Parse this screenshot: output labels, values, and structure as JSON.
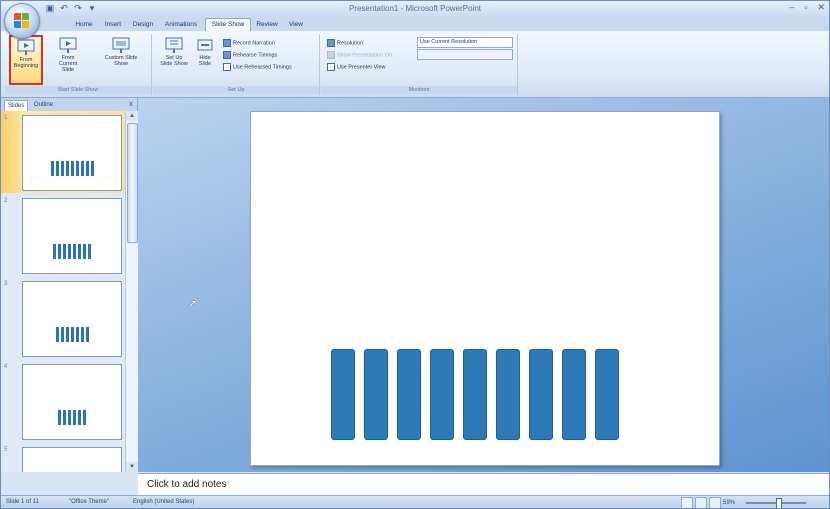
{
  "window": {
    "title": "Presentation1 - Microsoft PowerPoint",
    "controls": [
      "–",
      "▫",
      "✕"
    ]
  },
  "quick_access": [
    "save-icon",
    "undo-icon",
    "redo-icon",
    "dropdown-icon"
  ],
  "tabs": [
    {
      "label": "Home",
      "active": false
    },
    {
      "label": "Insert",
      "active": false
    },
    {
      "label": "Design",
      "active": false
    },
    {
      "label": "Animations",
      "active": false
    },
    {
      "label": "Slide Show",
      "active": true
    },
    {
      "label": "Review",
      "active": false
    },
    {
      "label": "View",
      "active": false
    }
  ],
  "ribbon": {
    "start_group": {
      "label": "Start Slide Show",
      "from_beginning": "From Beginning",
      "from_current": "From Current Slide",
      "custom": "Custom Slide Show"
    },
    "setup_group": {
      "label": "Set Up",
      "setup_show": "Set Up Slide Show",
      "hide_slide": "Hide Slide",
      "record_narration": "Record Narration",
      "rehearse": "Rehearse Timings",
      "use_timings": "Use Rehearsed Timings"
    },
    "monitors_group": {
      "label": "Monitors",
      "resolution_label": "Resolution:",
      "resolution_value": "Use Current Resolution",
      "show_on": "Show Presentation On:",
      "presenter_view": "Use Presenter View"
    }
  },
  "left_pane": {
    "tab_slides": "Slides",
    "tab_outline": "Outline",
    "close": "x",
    "thumbnails": [
      {
        "number": "1",
        "bars": 9,
        "selected": true
      },
      {
        "number": "2",
        "bars": 8,
        "selected": false
      },
      {
        "number": "3",
        "bars": 7,
        "selected": false
      },
      {
        "number": "4",
        "bars": 6,
        "selected": false
      },
      {
        "number": "5",
        "bars": 0,
        "selected": false
      }
    ]
  },
  "slide": {
    "bar_count": 9
  },
  "notes": {
    "placeholder": "Click to add notes"
  },
  "status": {
    "slide_info": "Slide 1 of 11",
    "theme": "\"Office Theme\"",
    "language": "English (United States)",
    "zoom": "59%"
  }
}
